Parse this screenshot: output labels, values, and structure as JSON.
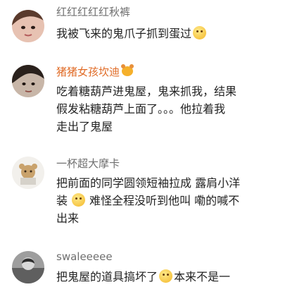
{
  "comments": [
    {
      "username": "红红红红红秋裤",
      "lines": [
        "我被飞来的鬼爪子抓到蛋过"
      ]
    },
    {
      "username": "猪猪女孩坎迪",
      "lines": [
        "吃着糖葫芦进鬼屋，鬼来抓我，结果",
        "假发粘糖葫芦上面了。。。他拉着我",
        "走出了鬼屋"
      ]
    },
    {
      "username": "一杯超大摩卡",
      "line1": "把前面的同学圆领短袖拉成 露肩小洋",
      "line2_a": "装",
      "line2_b": "难怪全程没听到他叫  嘞的喊不",
      "line3": "出来"
    },
    {
      "username": "swaleeeee",
      "line1_a": "把鬼屋的道具搞坏了",
      "line1_b": "本来不是一"
    }
  ],
  "colors": {
    "username": "#6f6f6f",
    "vip_username": "#e06b26",
    "text": "#222222",
    "emoji": "#f3b728"
  },
  "icons": [
    "avatar",
    "smile-emoji-icon",
    "bear-badge-icon",
    "grin-emoji-icon",
    "awkward-emoji-icon"
  ]
}
